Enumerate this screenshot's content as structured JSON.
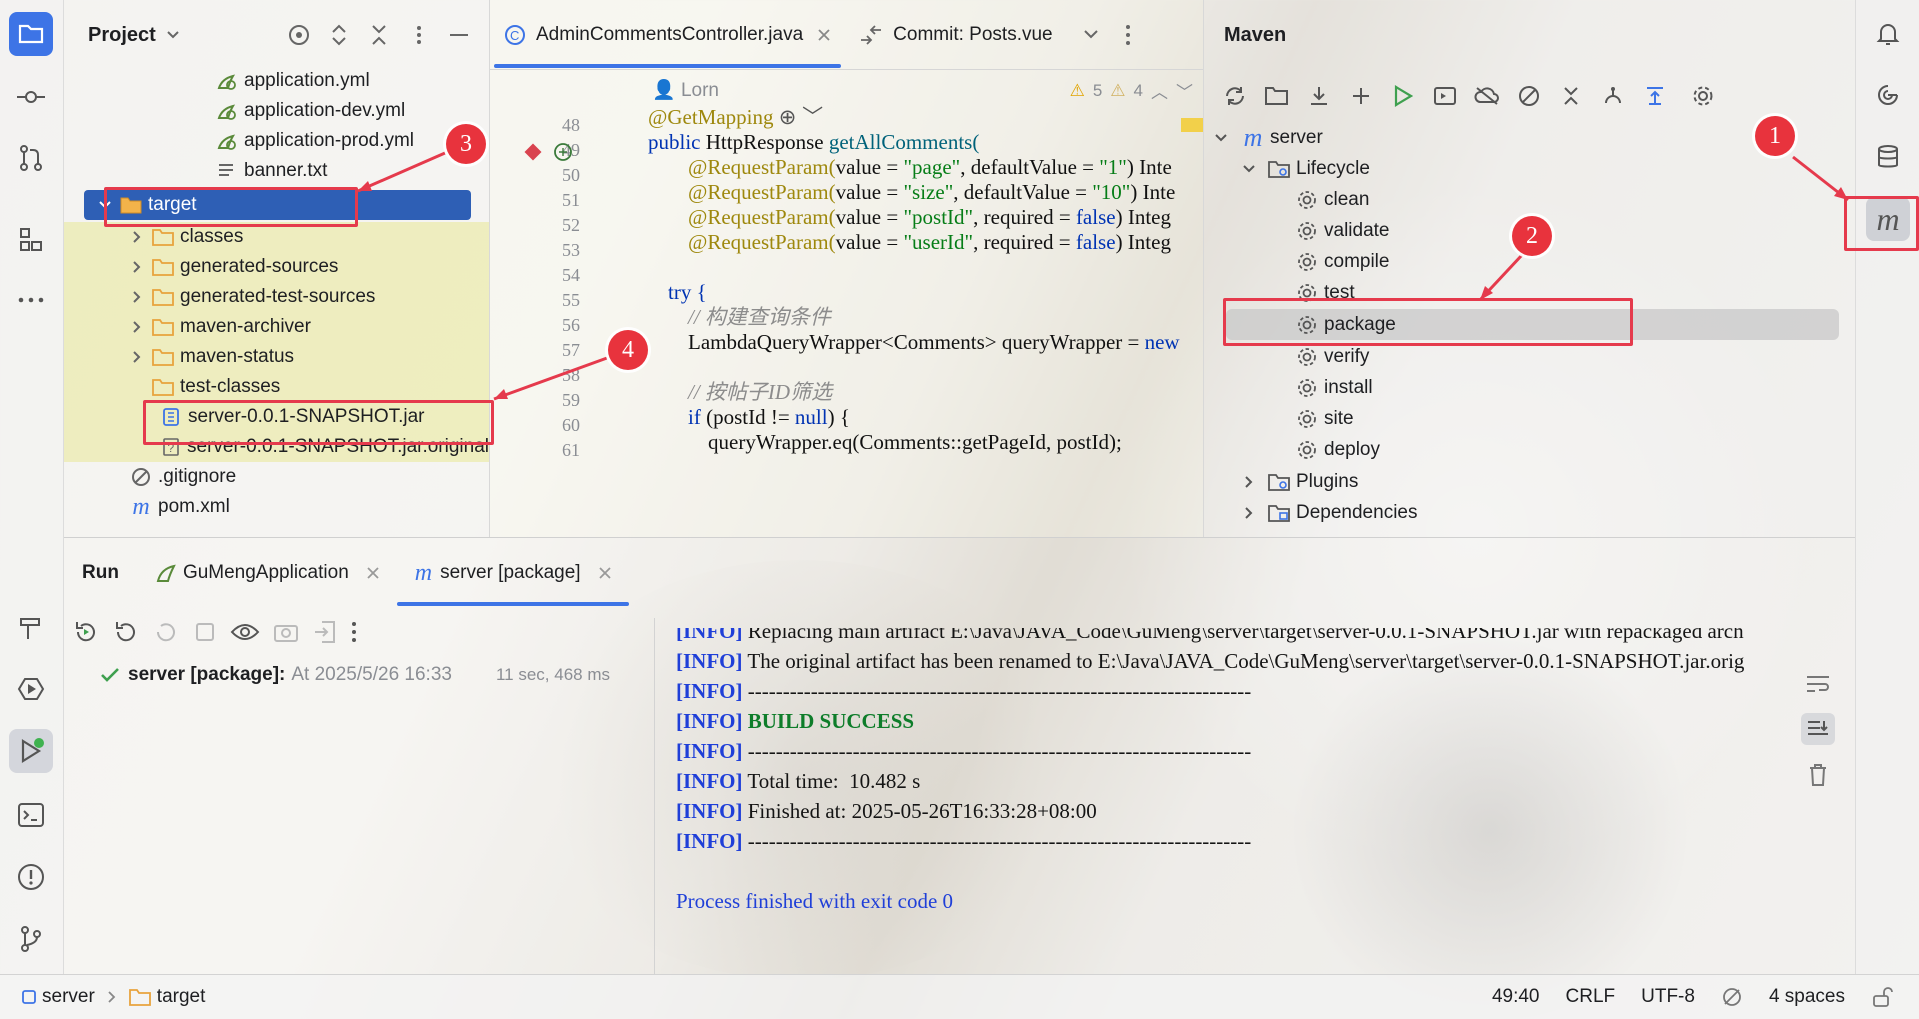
{
  "project_panel": {
    "title": "Project",
    "files_top": [
      {
        "name": "application.yml",
        "icon": "yaml-config-icon"
      },
      {
        "name": "application-dev.yml",
        "icon": "yaml-config-icon"
      },
      {
        "name": "application-prod.yml",
        "icon": "yaml-config-icon"
      },
      {
        "name": "banner.txt",
        "icon": "text-file-icon"
      }
    ],
    "target_folder": "target",
    "target_children": [
      "classes",
      "generated-sources",
      "generated-test-sources",
      "maven-archiver",
      "maven-status",
      "test-classes"
    ],
    "jar_file": "server-0.0.1-SNAPSHOT.jar",
    "jar_original": "server-0.0.1-SNAPSHOT.jar.original",
    "root_files": [
      ".gitignore",
      "pom.xml"
    ]
  },
  "editor": {
    "tabs": [
      {
        "label": "AdminCommentsController.java",
        "active": true
      },
      {
        "label": "Commit: Posts.vue",
        "active": false
      }
    ],
    "author": "Lorn",
    "warnings": "5",
    "weak_warnings": "4",
    "line_numbers": [
      "48",
      "49",
      "50",
      "51",
      "52",
      "53",
      "54",
      "55",
      "56",
      "57",
      "58",
      "59",
      "60",
      "61"
    ],
    "lines": {
      "l48": "@GetMapping",
      "l49a": "public ",
      "l49b": "HttpResponse ",
      "l49c": "getAllComments(",
      "l50a": "@RequestParam(",
      "l50b": "value = ",
      "l50c": "\"page\"",
      "l50d": ", defaultValue = ",
      "l50e": "\"1\"",
      "l50f": ") Inte",
      "l51a": "@RequestParam(",
      "l51b": "value = ",
      "l51c": "\"size\"",
      "l51d": ", defaultValue = ",
      "l51e": "\"10\"",
      "l51f": ") Inte",
      "l52a": "@RequestParam(",
      "l52b": "value = ",
      "l52c": "\"postId\"",
      "l52d": ", required = ",
      "l52e": "false",
      "l52f": ") Integ",
      "l53a": "@RequestParam(",
      "l53b": "value = ",
      "l53c": "\"userId\"",
      "l53d": ", required = ",
      "l53e": "false",
      "l53f": ") Integ",
      "l55": "try {",
      "l56": "// 构建查询条件",
      "l57a": "LambdaQueryWrapper<Comments> queryWrapper = ",
      "l57b": "new",
      "l59": "// 按帖子ID筛选",
      "l60a": "if ",
      "l60b": "(postId != ",
      "l60c": "null",
      "l60d": ") {",
      "l61": "queryWrapper.eq(Comments::getPageId, postId);"
    }
  },
  "maven": {
    "title": "Maven",
    "project": "server",
    "lifecycle": "Lifecycle",
    "goals": [
      "clean",
      "validate",
      "compile",
      "test",
      "package",
      "verify",
      "install",
      "site",
      "deploy"
    ],
    "plugins": "Plugins",
    "dependencies": "Dependencies"
  },
  "run": {
    "tabs": [
      {
        "label": "Run"
      },
      {
        "label": "GuMengApplication"
      },
      {
        "label": "server [package]"
      }
    ],
    "entry_name": "server [package]:",
    "entry_time": "At 2025/5/26 16:33",
    "entry_duration": "11 sec, 468 ms",
    "console": [
      {
        "tag": "[INFO]",
        "text": " Replacing main artifact E:\\Java\\JAVA_Code\\GuMeng\\server\\target\\server-0.0.1-SNAPSHOT.jar with repackaged arch"
      },
      {
        "tag": "[INFO]",
        "text": " The original artifact has been renamed to E:\\Java\\JAVA_Code\\GuMeng\\server\\target\\server-0.0.1-SNAPSHOT.jar.orig"
      },
      {
        "tag": "[INFO]",
        "text": " ------------------------------------------------------------------------"
      },
      {
        "tag": "[INFO]",
        "text": " BUILD SUCCESS",
        "success": true
      },
      {
        "tag": "[INFO]",
        "text": " ------------------------------------------------------------------------"
      },
      {
        "tag": "[INFO]",
        "text": " Total time:  10.482 s"
      },
      {
        "tag": "[INFO]",
        "text": " Finished at: 2025-05-26T16:33:28+08:00"
      },
      {
        "tag": "[INFO]",
        "text": " ------------------------------------------------------------------------"
      }
    ],
    "finished": "Process finished with exit code 0"
  },
  "status_bar": {
    "crumb1": "server",
    "crumb2": "target",
    "position": "49:40",
    "line_sep": "CRLF",
    "encoding": "UTF-8",
    "indent": "4 spaces"
  },
  "annotations": [
    "1",
    "2",
    "3",
    "4"
  ],
  "colors": {
    "accent": "#3d74e6",
    "selection": "#2e5fb5",
    "annotation": "#e8333d",
    "info": "#1f3fd8",
    "success": "#0e7d2a",
    "folder": "#e8a33d"
  }
}
